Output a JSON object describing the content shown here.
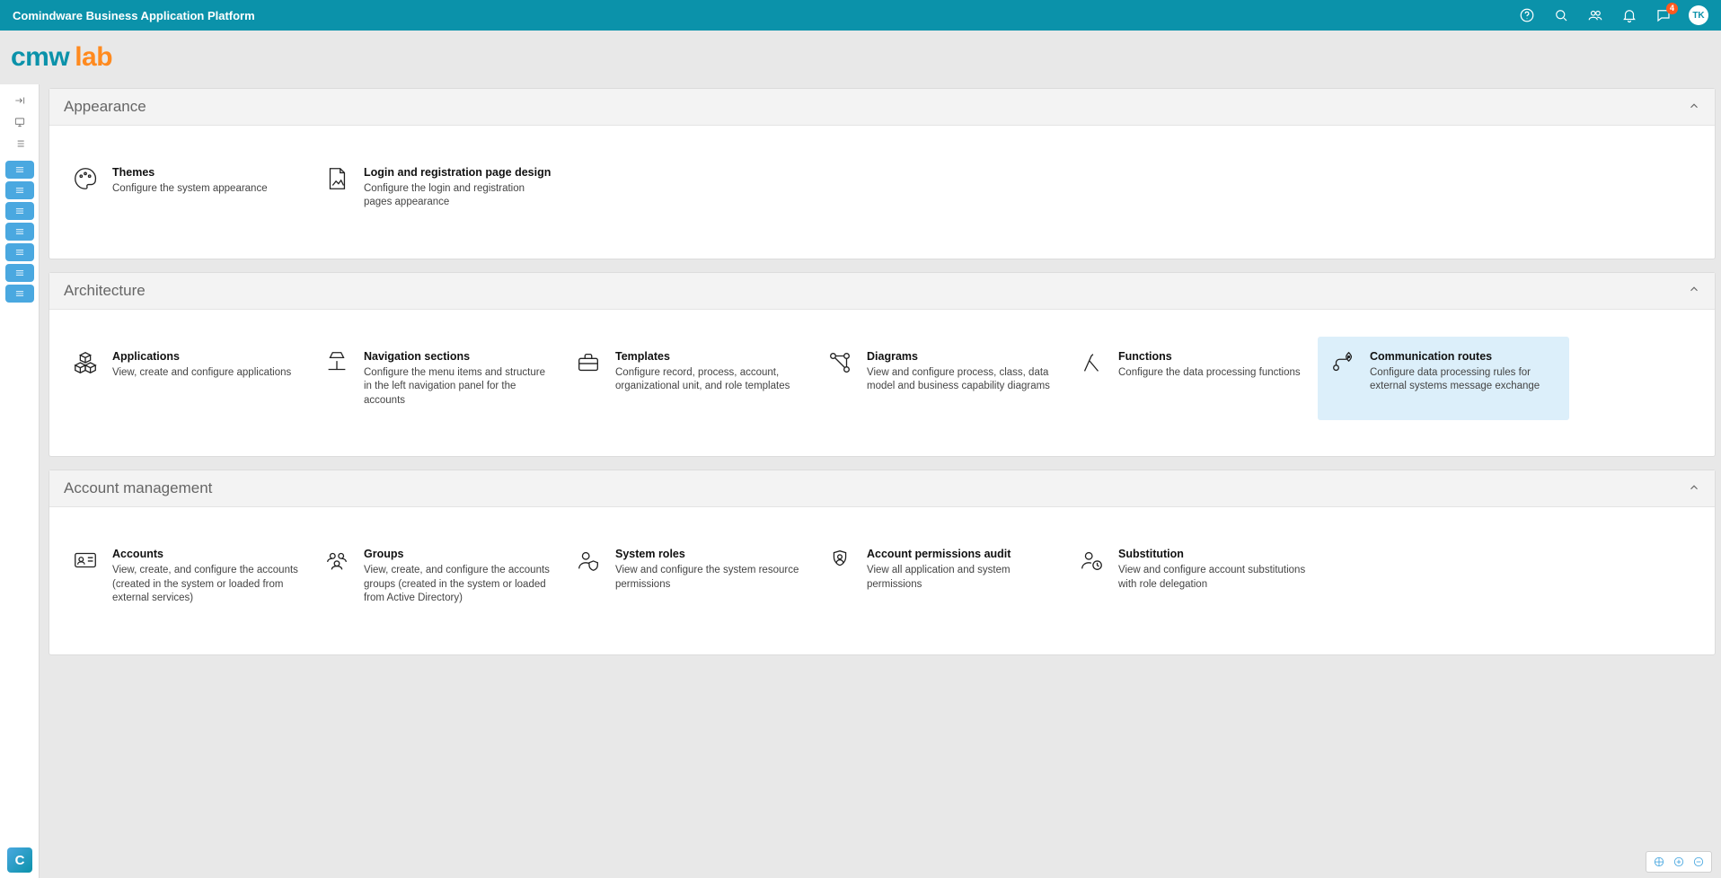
{
  "topbar": {
    "title": "Comindware Business Application Platform",
    "notification_badge": "4",
    "avatar_initials": "TK"
  },
  "logo": {
    "part1": "cmw",
    "part2": "lab"
  },
  "sections": [
    {
      "title": "Appearance",
      "cards": [
        {
          "id": "themes",
          "title": "Themes",
          "desc": "Configure the system appearance",
          "icon": "palette"
        },
        {
          "id": "login-design",
          "title": "Login and registration page design",
          "desc": "Configure the login and registration pages appearance",
          "icon": "page-image"
        }
      ]
    },
    {
      "title": "Architecture",
      "cards": [
        {
          "id": "applications",
          "title": "Applications",
          "desc": "View, create and configure applications",
          "icon": "cubes"
        },
        {
          "id": "nav-sections",
          "title": "Navigation sections",
          "desc": "Configure the menu items and structure in the left navigation panel for the accounts",
          "icon": "lamp"
        },
        {
          "id": "templates",
          "title": "Templates",
          "desc": "Configure record, process, account, organizational unit, and role templates",
          "icon": "briefcase"
        },
        {
          "id": "diagrams",
          "title": "Diagrams",
          "desc": "View and configure process, class, data model and business capability diagrams",
          "icon": "nodes"
        },
        {
          "id": "functions",
          "title": "Functions",
          "desc": "Configure the data processing functions",
          "icon": "lambda"
        },
        {
          "id": "comm-routes",
          "title": "Communication routes",
          "desc": "Configure data processing rules for external systems message exchange",
          "icon": "route",
          "selected": true
        }
      ]
    },
    {
      "title": "Account management",
      "cards": [
        {
          "id": "accounts",
          "title": "Accounts",
          "desc": "View, create, and configure the accounts (created in the system or loaded from external services)",
          "icon": "id-card"
        },
        {
          "id": "groups",
          "title": "Groups",
          "desc": "View, create, and configure the accounts groups (created in the system or loaded from Active Directory)",
          "icon": "group"
        },
        {
          "id": "system-roles",
          "title": "System roles",
          "desc": "View and configure the system resource permissions",
          "icon": "user-shield"
        },
        {
          "id": "perm-audit",
          "title": "Account permissions audit",
          "desc": "View all application and system permissions",
          "icon": "user-badge"
        },
        {
          "id": "substitution",
          "title": "Substitution",
          "desc": "View and configure account substitutions with role delegation",
          "icon": "user-clock"
        }
      ]
    }
  ]
}
